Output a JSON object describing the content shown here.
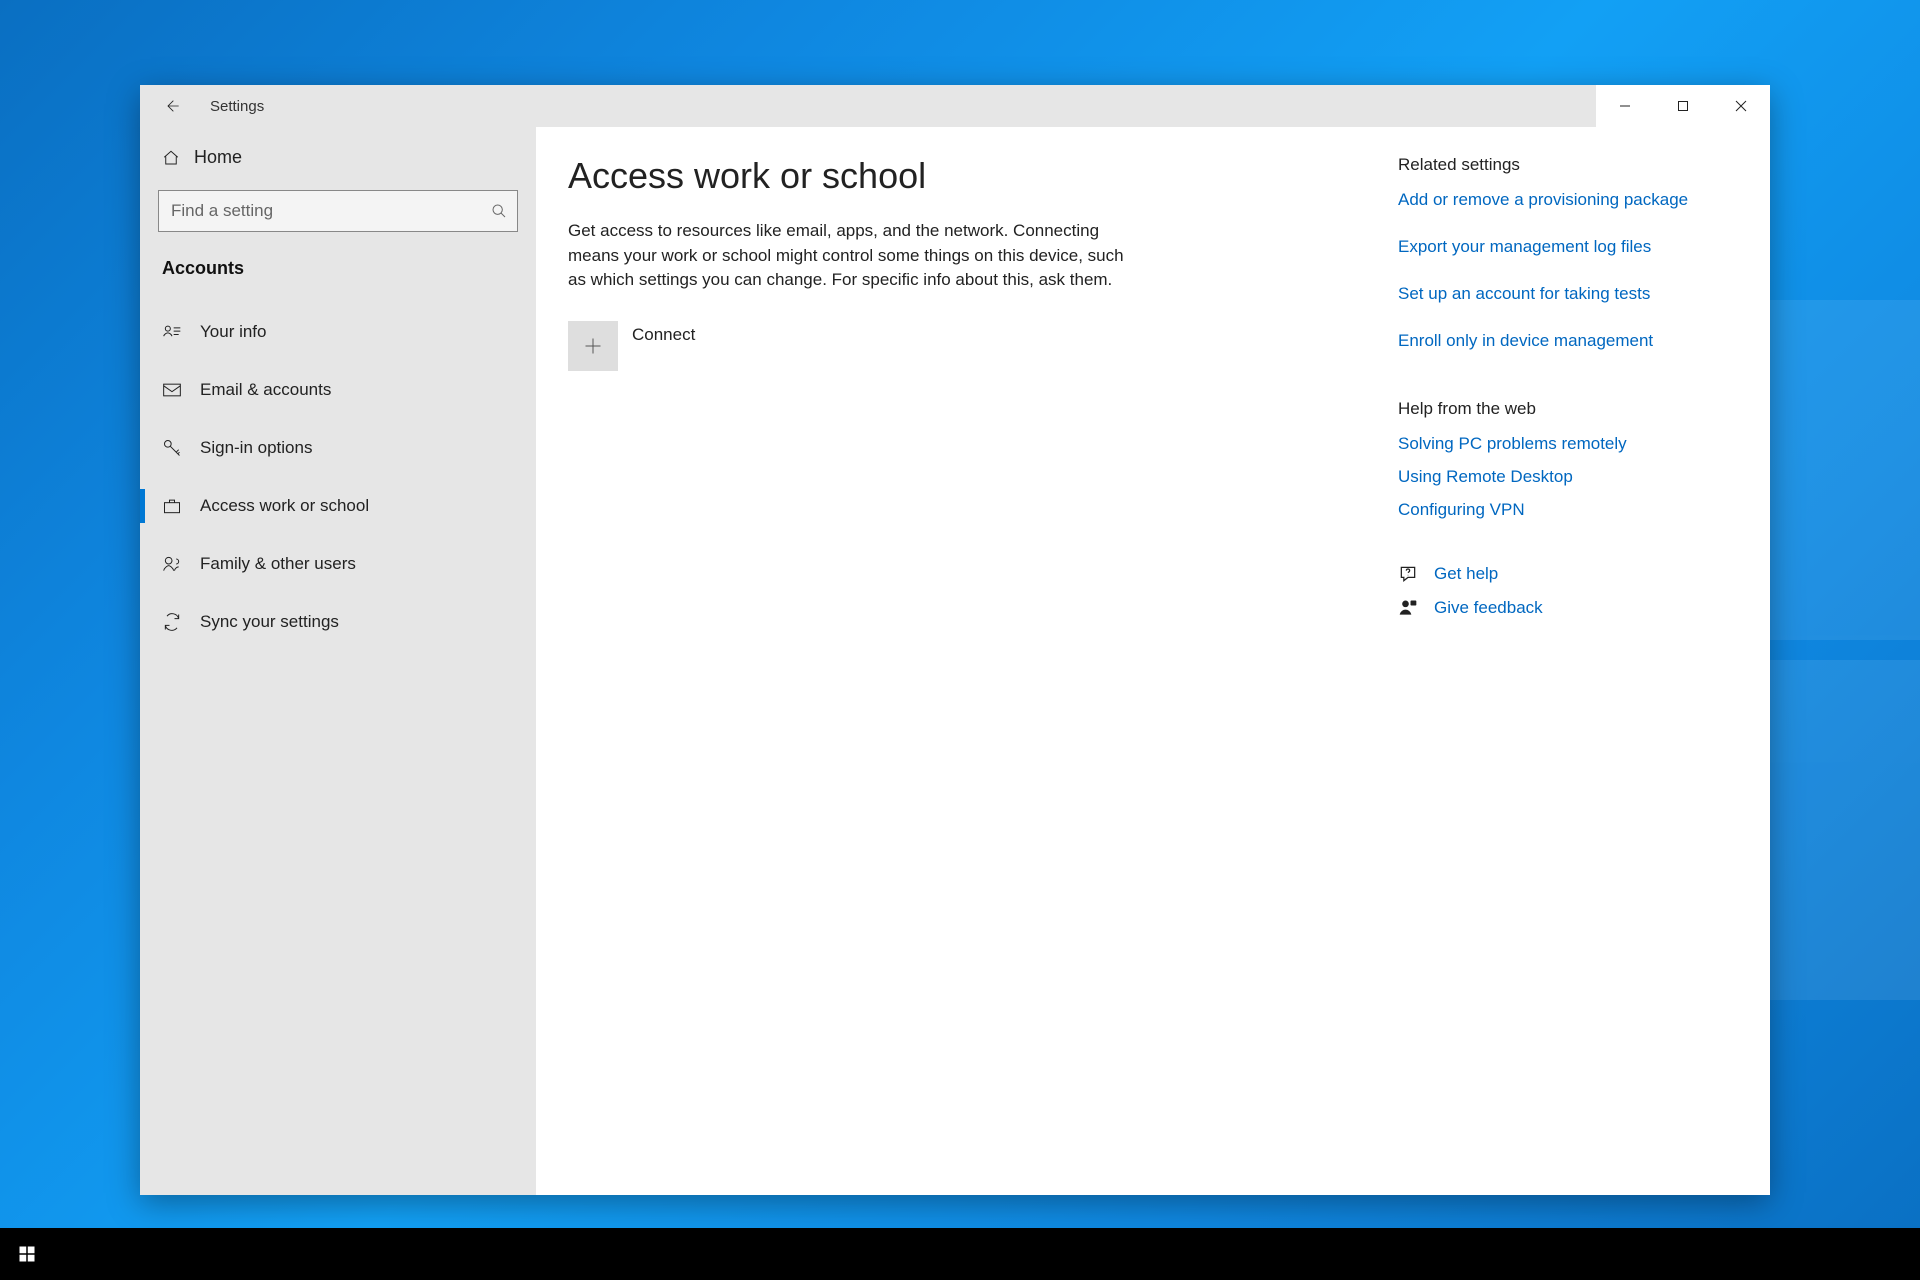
{
  "window": {
    "title": "Settings"
  },
  "sidebar": {
    "home_label": "Home",
    "search_placeholder": "Find a setting",
    "section_title": "Accounts",
    "items": [
      {
        "label": "Your info"
      },
      {
        "label": "Email & accounts"
      },
      {
        "label": "Sign-in options"
      },
      {
        "label": "Access work or school"
      },
      {
        "label": "Family & other users"
      },
      {
        "label": "Sync your settings"
      }
    ],
    "active_index": 3
  },
  "main": {
    "title": "Access work or school",
    "description": "Get access to resources like email, apps, and the network. Connecting means your work or school might control some things on this device, such as which settings you can change. For specific info about this, ask them.",
    "connect_label": "Connect"
  },
  "right": {
    "related_heading": "Related settings",
    "related_links": [
      "Add or remove a provisioning package",
      "Export your management log files",
      "Set up an account for taking tests",
      "Enroll only in device management"
    ],
    "help_heading": "Help from the web",
    "help_links": [
      "Solving PC problems remotely",
      "Using Remote Desktop",
      "Configuring VPN"
    ],
    "get_help_label": "Get help",
    "give_feedback_label": "Give feedback"
  }
}
